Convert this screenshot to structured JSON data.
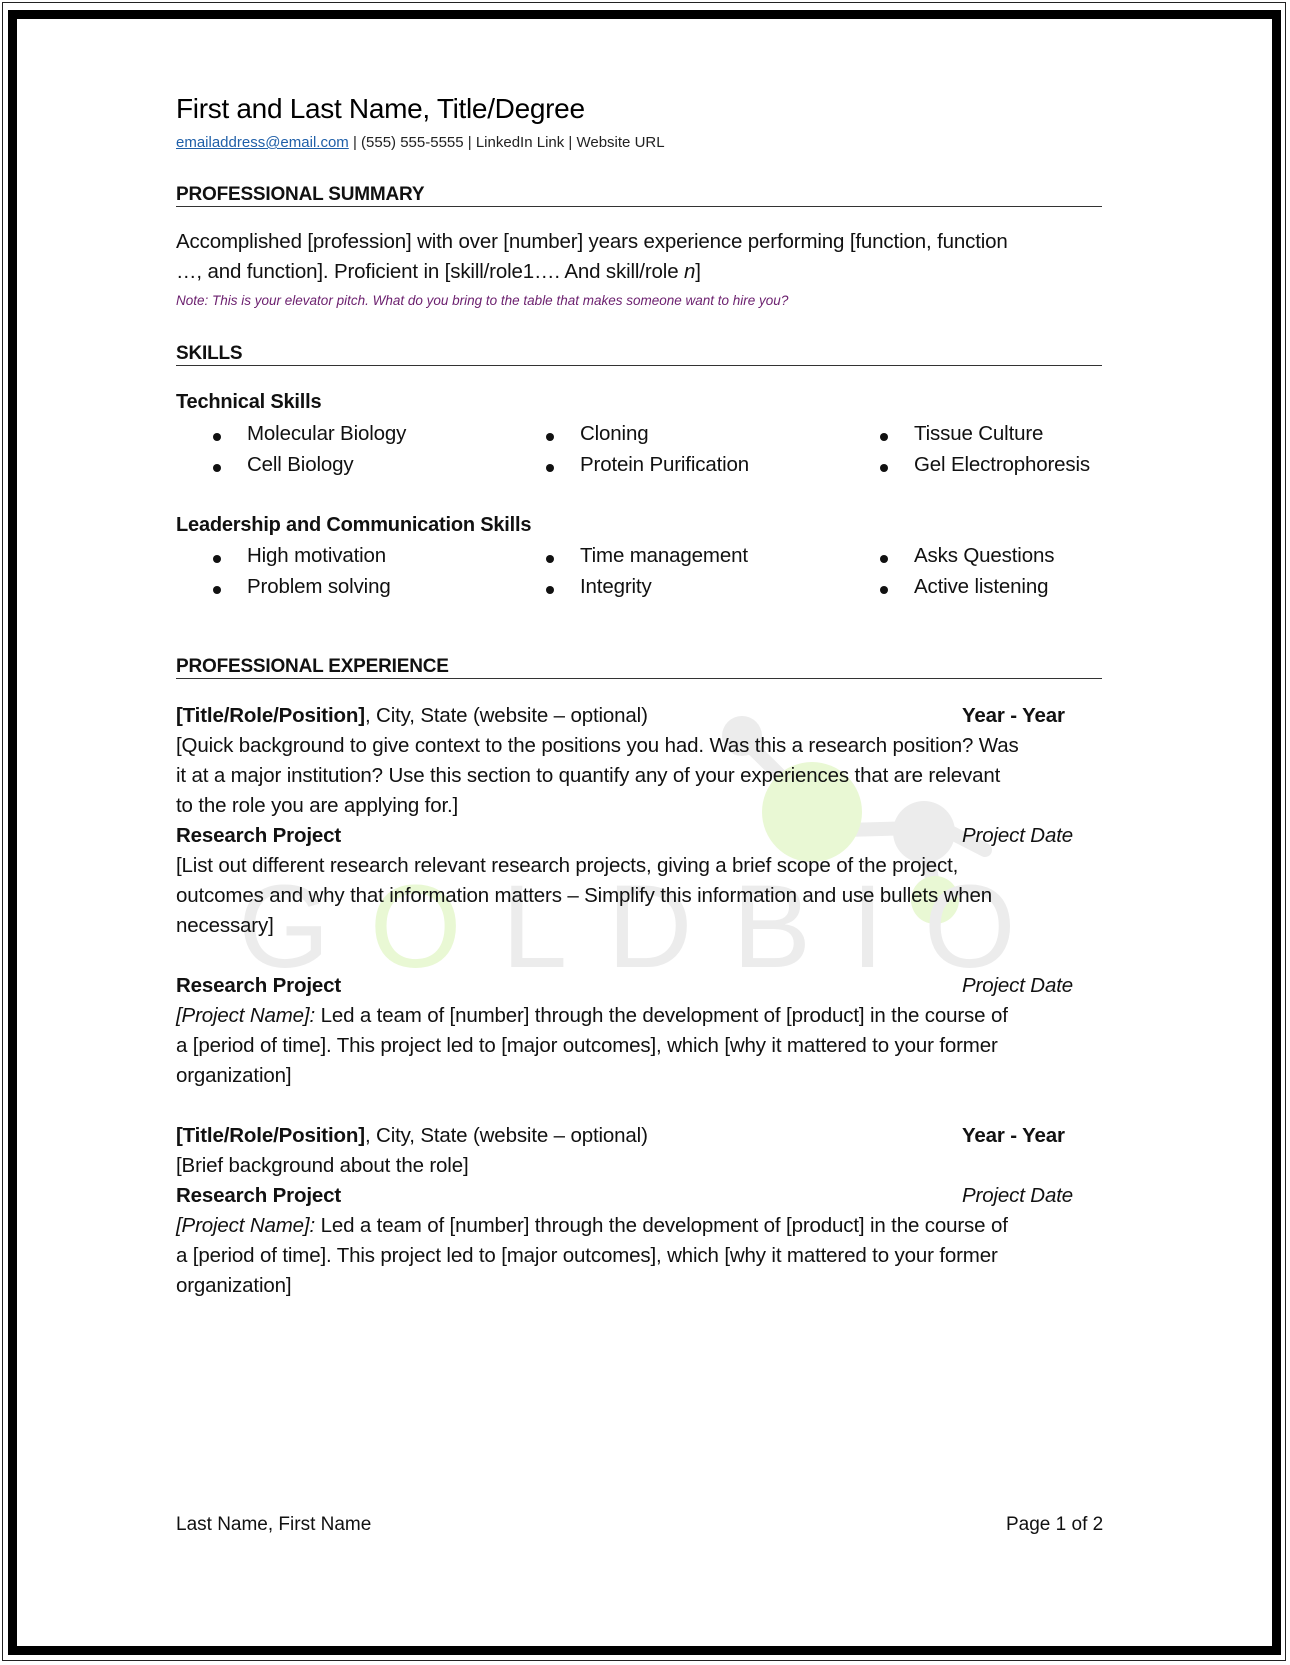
{
  "header": {
    "name_title": "First and Last Name, Title/Degree",
    "email": "emailaddress@email.com",
    "separator": " | ",
    "phone": "(555) 555-5555",
    "linkedin": "LinkedIn Link",
    "website": "Website URL"
  },
  "summary": {
    "heading": "PROFESSIONAL SUMMARY",
    "line1": "Accomplished [profession] with over [number] years experience performing [function, function",
    "line2_prefix": "…, and function]. Proficient in [skill/role1…. And skill/role ",
    "line2_italic": "n",
    "line2_suffix": "]",
    "note": "Note: This is your elevator pitch. What do you bring to the table that makes someone want to hire you?",
    "note_color": "#6b1f6e"
  },
  "skills": {
    "heading": "SKILLS",
    "groups": [
      {
        "title": "Technical Skills",
        "columns": [
          [
            "Molecular Biology",
            "Cell Biology"
          ],
          [
            "Cloning",
            "Protein Purification"
          ],
          [
            "Tissue Culture",
            "Gel Electrophoresis"
          ]
        ]
      },
      {
        "title": "Leadership and Communication Skills",
        "columns": [
          [
            "High motivation",
            "Problem solving"
          ],
          [
            "Time management",
            "Integrity"
          ],
          [
            "Asks Questions",
            "Active listening"
          ]
        ]
      }
    ]
  },
  "experience": {
    "heading": "PROFESSIONAL EXPERIENCE",
    "positions": [
      {
        "title": "[Title/Role/Position]",
        "location": ", City, State (website – optional)",
        "dates": "Year - Year",
        "background": [
          "[Quick background to give context to the positions you had. Was this a research position? Was",
          "it at a major institution? Use this section to quantify any of your experiences that are relevant",
          "to the role you are applying for.]"
        ],
        "projects": [
          {
            "label": "Research Project",
            "date": "Project Date",
            "lines": [
              "[List out different research relevant research projects, giving a brief scope of the project,",
              "outcomes and why that information matters – Simplify this information and use bullets when",
              "necessary]"
            ]
          },
          {
            "label": "Research Project",
            "date": "Project Date",
            "name": "[Project Name]:",
            "lines": [
              " Led a team of [number] through the development of [product] in the course of",
              "a [period of time]. This project led to [major outcomes], which [why it mattered to your former",
              "organization]"
            ]
          }
        ]
      },
      {
        "title": "[Title/Role/Position]",
        "location": ", City, State (website – optional)",
        "dates": "Year - Year",
        "background": [
          "[Brief background about the role]"
        ],
        "projects": [
          {
            "label": "Research Project",
            "date": "Project Date",
            "name": "[Project Name]:",
            "lines": [
              " Led a team of [number] through the development of [product] in the course of",
              "a [period of time]. This project led to [major outcomes], which [why it mattered to your former",
              "organization]"
            ]
          }
        ]
      }
    ]
  },
  "footer": {
    "left": "Last Name, First Name",
    "right": "Page 1 of 2"
  },
  "watermark": {
    "text_before": "G",
    "text_green": "O",
    "text_after": "LDBIO",
    "gray": "#ececec",
    "green": "#e9f8d4"
  },
  "colors": {
    "link": "#1f5fa8",
    "border": "#000000"
  }
}
